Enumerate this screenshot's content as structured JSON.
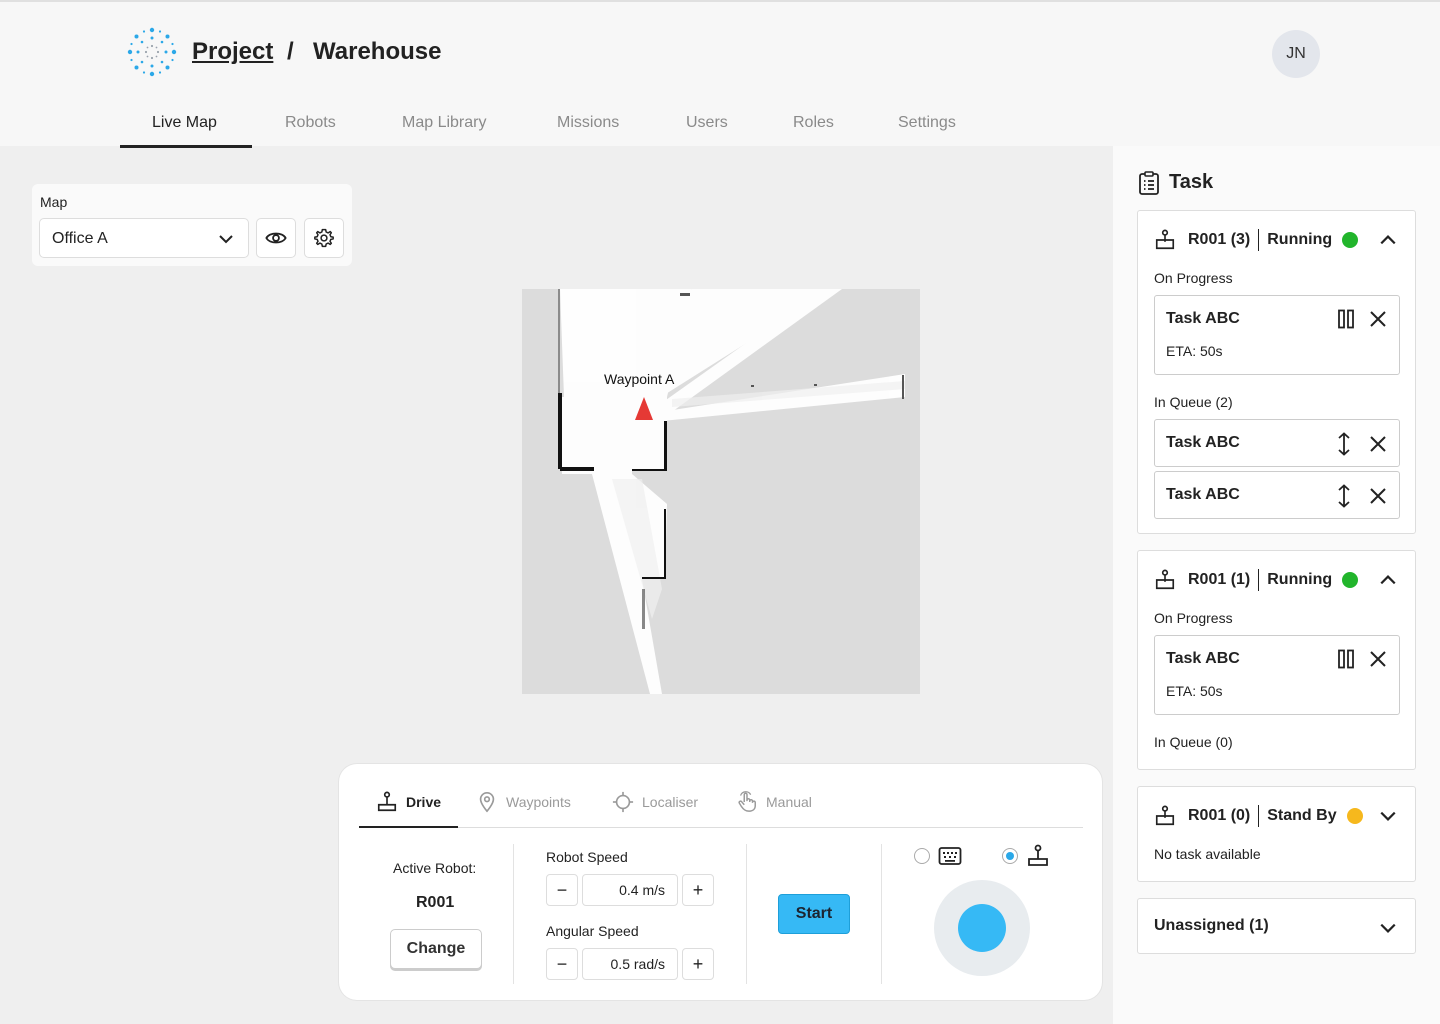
{
  "header": {
    "breadcrumb_project": "Project",
    "breadcrumb_sep": "/",
    "breadcrumb_current": "Warehouse",
    "avatar_initials": "JN"
  },
  "nav": {
    "tabs": [
      "Live Map",
      "Robots",
      "Map Library",
      "Missions",
      "Users",
      "Roles",
      "Settings"
    ],
    "active": "Live Map"
  },
  "map_selector": {
    "label": "Map",
    "value": "Office A",
    "icons": [
      "chevron-down-icon",
      "eye-icon",
      "gear-icon"
    ]
  },
  "map": {
    "waypoint_label": "Waypoint A",
    "robot_marker_color": "#e53935"
  },
  "drive_panel": {
    "tabs": [
      {
        "label": "Drive",
        "icon": "joystick-icon",
        "active": true
      },
      {
        "label": "Waypoints",
        "icon": "location-pin-icon",
        "active": false
      },
      {
        "label": "Localiser",
        "icon": "crosshair-icon",
        "active": false
      },
      {
        "label": "Manual",
        "icon": "hand-pointer-icon",
        "active": false
      }
    ],
    "active_robot_label": "Active Robot:",
    "active_robot_value": "R001",
    "change_label": "Change",
    "robot_speed_label": "Robot Speed",
    "robot_speed_value": "0.4 m/s",
    "angular_speed_label": "Angular Speed",
    "angular_speed_value": "0.5 rad/s",
    "minus": "−",
    "plus": "+",
    "start_label": "Start",
    "control_modes": [
      {
        "icon": "keyboard-icon",
        "selected": false
      },
      {
        "icon": "joystick-icon",
        "selected": true
      }
    ],
    "accent_color": "#36b9f5"
  },
  "sidebar": {
    "title": "Task",
    "robots": [
      {
        "name": "R001 (3)",
        "status": "Running",
        "status_color": "#22b52c",
        "expanded": true,
        "on_progress_label": "On Progress",
        "current_task": {
          "name": "Task ABC",
          "eta": "ETA: 50s"
        },
        "queue_label": "In Queue (2)",
        "queue": [
          "Task ABC",
          "Task ABC"
        ]
      },
      {
        "name": "R001 (1)",
        "status": "Running",
        "status_color": "#22b52c",
        "expanded": true,
        "on_progress_label": "On Progress",
        "current_task": {
          "name": "Task ABC",
          "eta": "ETA: 50s"
        },
        "queue_label": "In Queue (0)",
        "queue": []
      },
      {
        "name": "R001 (0)",
        "status": "Stand By",
        "status_color": "#f6b81d",
        "expanded": false,
        "empty_label": "No task available"
      }
    ],
    "unassigned_label": "Unassigned (1)"
  }
}
